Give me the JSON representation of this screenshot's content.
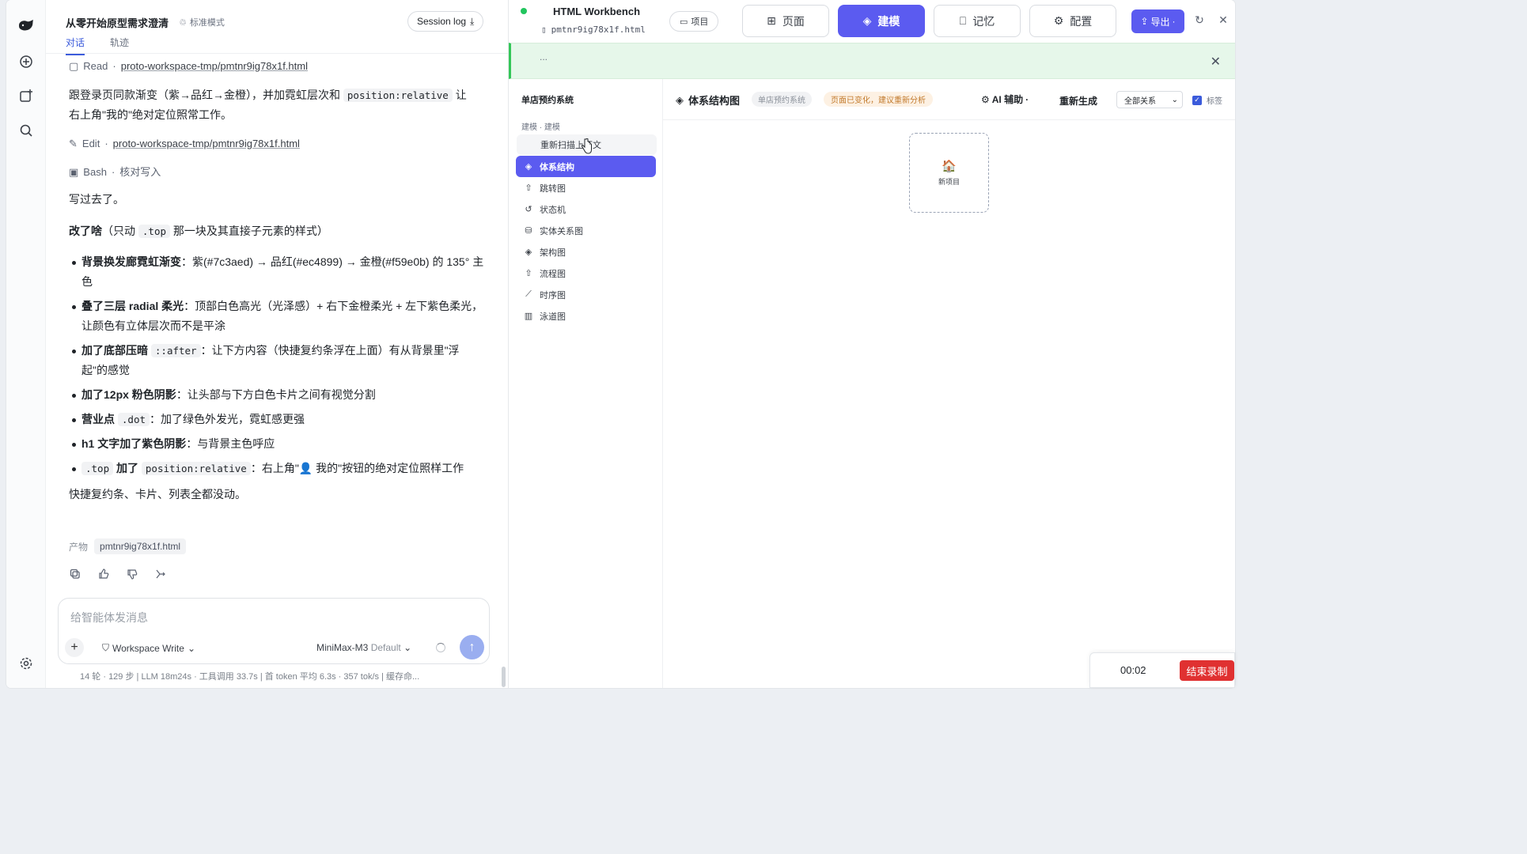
{
  "chat": {
    "title": "从零开始原型需求澄清",
    "mode_label": "标准模式",
    "session_log": "Session log",
    "tabs": [
      "对话",
      "轨迹"
    ],
    "tool_read_label": "Read",
    "tool_read_path": "proto-workspace-tmp/pmtnr9ig78x1f.html",
    "intro_text_1": "跟登录页同款渐变（紫→品红→金橙），并加霓虹层次和",
    "intro_code": "position:relative",
    "intro_text_2": "让",
    "intro_text_3": "右上角\"我的\"绝对定位照常工作。",
    "tool_edit_label": "Edit",
    "tool_edit_path": "proto-workspace-tmp/pmtnr9ig78x1f.html",
    "tool_bash_label": "Bash",
    "tool_bash_desc": "核对写入",
    "written": "写过去了。",
    "changed_head": "改了啥",
    "changed_paren_1": "（只动",
    "changed_code": ".top",
    "changed_paren_2": "那一块及其直接子元素的样式）",
    "bullets": [
      {
        "bold": "背景换发廊霓虹渐变",
        "rest": "：紫(#7c3aed) → 品红(#ec4899) → 金橙(#f59e0b) 的 135° 主色"
      },
      {
        "bold": "叠了三层 radial 柔光",
        "rest": "：顶部白色高光（光泽感）+ 右下金橙柔光 + 左下紫色柔光，让颜色有立体层次而不是平涂"
      },
      {
        "bold": "加了底部压暗",
        "code": "::after",
        "rest": "：让下方内容（快捷复约条浮在上面）有从背景里\"浮起\"的感觉"
      },
      {
        "bold": "加了12px 粉色阴影",
        "rest": "：让头部与下方白色卡片之间有视觉分割"
      },
      {
        "bold": "营业点",
        "code": ".dot",
        "rest": "：加了绿色外发光，霓虹感更强"
      },
      {
        "bold": "h1 文字加了紫色阴影",
        "rest": "：与背景主色呼应"
      },
      {
        "code_pre": ".top",
        "bold": "加了",
        "code": "position:relative",
        "rest": "：右上角\"👤 我的\"按钮的绝对定位照样工作"
      }
    ],
    "closing": "快捷复约条、卡片、列表全都没动。",
    "artifact_label": "产物",
    "artifact_file": "pmtnr9ig78x1f.html",
    "composer_placeholder": "给智能体发消息",
    "workspace_mode": "Workspace Write",
    "model_name": "MiniMax-M3",
    "model_default": "Default",
    "stats": "14 轮 · 129 步  |  LLM 18m24s · 工具调用 33.7s  |  首 token 平均 6.3s · 357 tok/s  |  缓存命..."
  },
  "workbench": {
    "title": "HTML Workbench",
    "file": "pmtnr9ig78x1f.html",
    "project_btn": "项目",
    "nav": [
      {
        "label": "页面",
        "icon": "grid-icon"
      },
      {
        "label": "建模",
        "icon": "layers-icon"
      },
      {
        "label": "记忆",
        "icon": "bookmark-icon"
      },
      {
        "label": "配置",
        "icon": "gear-icon"
      }
    ],
    "active_nav": "建模",
    "export_label": "导出",
    "banner_text": "..."
  },
  "sidebar": {
    "project": "单店预约系统",
    "crumb": "建模 · 建模",
    "rescan": "重新扫描上下文",
    "items": [
      {
        "label": "体系结构",
        "icon": "layers-icon"
      },
      {
        "label": "跳转图",
        "icon": "share-icon"
      },
      {
        "label": "状态机",
        "icon": "history-icon"
      },
      {
        "label": "实体关系图",
        "icon": "database-icon"
      },
      {
        "label": "架构图",
        "icon": "layers-icon"
      },
      {
        "label": "流程图",
        "icon": "share-icon"
      },
      {
        "label": "时序图",
        "icon": "line-chart-icon"
      },
      {
        "label": "泳道图",
        "icon": "bar-chart-icon"
      }
    ],
    "active_item": "体系结构"
  },
  "canvas": {
    "title": "体系结构图",
    "tag_project": "单店预约系统",
    "tag_warning": "页面已变化，建议重新分析",
    "ai_assist": "AI 辅助",
    "regenerate": "重新生成",
    "relation_select": "全部关系",
    "labels_checkbox": "标签",
    "node_label": "新项目",
    "node_emoji": "🏠"
  },
  "recorder": {
    "time": "00:02",
    "stop_label": "结束录制"
  },
  "colors": {
    "accent": "#5b5bf0",
    "link_blue": "#3b5bdb",
    "banner_green": "#e6f7ea",
    "stop_red": "#e03131"
  }
}
